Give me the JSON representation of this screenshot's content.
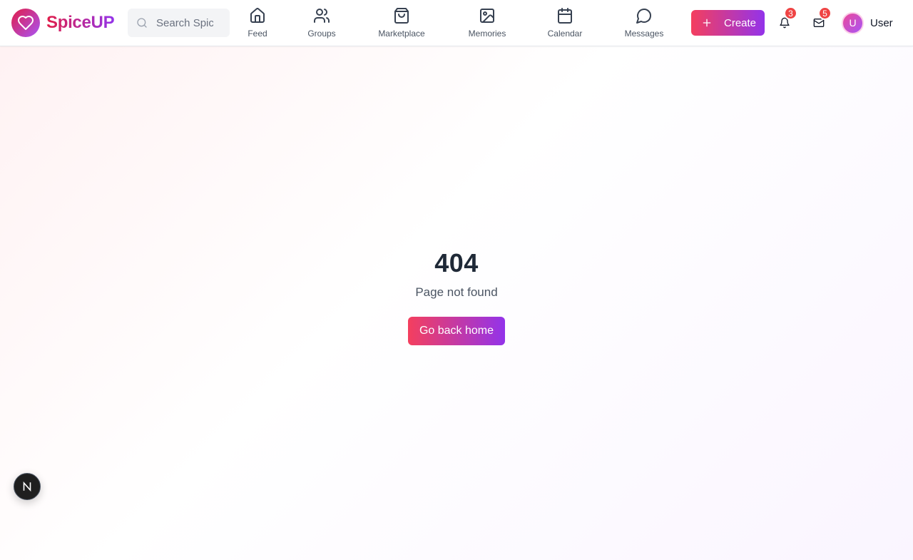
{
  "brand": {
    "name": "SpiceUP",
    "accent_start": "#e11d48",
    "accent_end": "#9333ea"
  },
  "search": {
    "placeholder": "Search SpiceUP..."
  },
  "nav": [
    {
      "label": "Feed",
      "icon": "home-icon"
    },
    {
      "label": "Groups",
      "icon": "users-icon"
    },
    {
      "label": "Marketplace",
      "icon": "shopping-bag-icon"
    },
    {
      "label": "Memories",
      "icon": "image-icon"
    },
    {
      "label": "Calendar",
      "icon": "calendar-icon"
    },
    {
      "label": "Messages",
      "icon": "message-circle-icon"
    }
  ],
  "actions": {
    "create_label": "Create",
    "notifications_count": "3",
    "messages_count": "5",
    "badge_color": "#ef4444"
  },
  "user": {
    "initial": "U",
    "name": "User"
  },
  "error": {
    "code": "404",
    "message": "Page not found",
    "home_button": "Go back home"
  },
  "dev_indicator": {
    "letter": "N"
  }
}
